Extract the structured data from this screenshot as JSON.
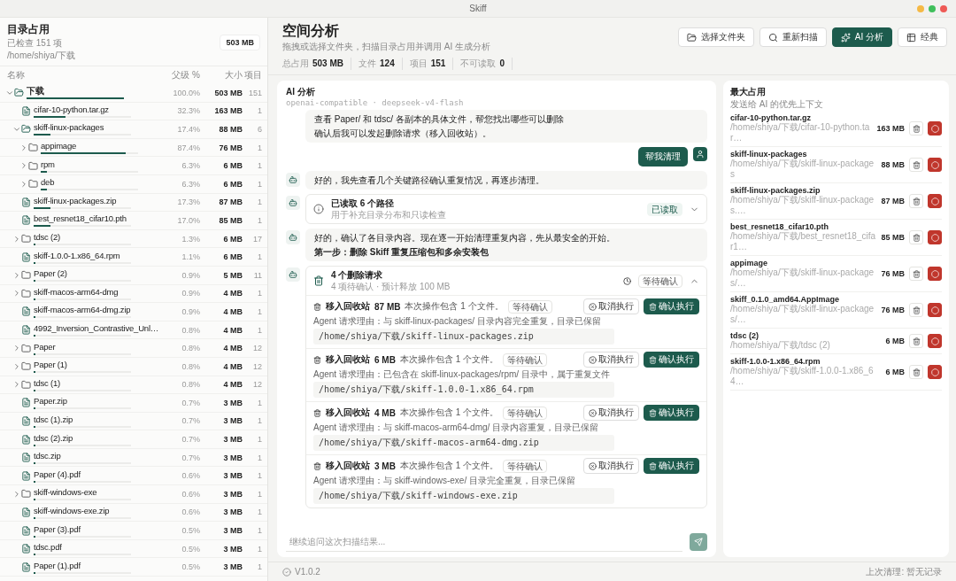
{
  "window": {
    "title": "Skiff"
  },
  "sidebar": {
    "title": "目录占用",
    "checked": "已检查 151 项",
    "path": "/home/shiya/下载",
    "total": "503 MB",
    "columns": [
      "名称",
      "父级 %",
      "大小",
      "项目"
    ],
    "tree": [
      {
        "name": "下载",
        "kind": "folder",
        "expanded": true,
        "percent": "100.0%",
        "size": "503 MB",
        "count": "151",
        "level": 1,
        "children": [
          {
            "name": "cifar-10-python.tar.gz",
            "kind": "file",
            "percent": "32.3%",
            "size": "163 MB",
            "count": "1",
            "level": 0.323
          },
          {
            "name": "skiff-linux-packages",
            "kind": "folder",
            "expanded": true,
            "percent": "17.4%",
            "size": "88 MB",
            "count": "6",
            "level": 0.174,
            "children": [
              {
                "name": "appimage",
                "kind": "folder",
                "expanded": false,
                "percent": "87.4%",
                "size": "76 MB",
                "count": "1",
                "level": 0.874
              },
              {
                "name": "rpm",
                "kind": "folder",
                "expanded": false,
                "percent": "6.3%",
                "size": "6 MB",
                "count": "1",
                "level": 0.063
              },
              {
                "name": "deb",
                "kind": "folder",
                "expanded": false,
                "percent": "6.3%",
                "size": "6 MB",
                "count": "1",
                "level": 0.063
              }
            ]
          },
          {
            "name": "skiff-linux-packages.zip",
            "kind": "file",
            "percent": "17.3%",
            "size": "87 MB",
            "count": "1",
            "level": 0.173
          },
          {
            "name": "best_resnet18_cifar10.pth",
            "kind": "file",
            "percent": "17.0%",
            "size": "85 MB",
            "count": "1",
            "level": 0.17
          },
          {
            "name": "tdsc (2)",
            "kind": "folder",
            "expanded": false,
            "percent": "1.3%",
            "size": "6 MB",
            "count": "17",
            "level": 0.013
          },
          {
            "name": "skiff-1.0.0-1.x86_64.rpm",
            "kind": "file",
            "percent": "1.1%",
            "size": "6 MB",
            "count": "1",
            "level": 0.011
          },
          {
            "name": "Paper (2)",
            "kind": "folder",
            "expanded": false,
            "percent": "0.9%",
            "size": "5 MB",
            "count": "11",
            "level": 0.009
          },
          {
            "name": "skiff-macos-arm64-dmg",
            "kind": "folder",
            "expanded": false,
            "percent": "0.9%",
            "size": "4 MB",
            "count": "1",
            "level": 0.009
          },
          {
            "name": "skiff-macos-arm64-dmg.zip",
            "kind": "file",
            "percent": "0.9%",
            "size": "4 MB",
            "count": "1",
            "level": 0.009
          },
          {
            "name": "4992_Inversion_Contrastive_Unl…",
            "kind": "file",
            "percent": "0.8%",
            "size": "4 MB",
            "count": "1",
            "level": 0.008
          },
          {
            "name": "Paper",
            "kind": "folder",
            "expanded": false,
            "percent": "0.8%",
            "size": "4 MB",
            "count": "12",
            "level": 0.008
          },
          {
            "name": "Paper (1)",
            "kind": "folder",
            "expanded": false,
            "percent": "0.8%",
            "size": "4 MB",
            "count": "12",
            "level": 0.008
          },
          {
            "name": "tdsc (1)",
            "kind": "folder",
            "expanded": false,
            "percent": "0.8%",
            "size": "4 MB",
            "count": "12",
            "level": 0.008
          },
          {
            "name": "Paper.zip",
            "kind": "file",
            "percent": "0.7%",
            "size": "3 MB",
            "count": "1",
            "level": 0.007
          },
          {
            "name": "tdsc (1).zip",
            "kind": "file",
            "percent": "0.7%",
            "size": "3 MB",
            "count": "1",
            "level": 0.007
          },
          {
            "name": "tdsc (2).zip",
            "kind": "file",
            "percent": "0.7%",
            "size": "3 MB",
            "count": "1",
            "level": 0.007
          },
          {
            "name": "tdsc.zip",
            "kind": "file",
            "percent": "0.7%",
            "size": "3 MB",
            "count": "1",
            "level": 0.007
          },
          {
            "name": "Paper (4).pdf",
            "kind": "file",
            "percent": "0.6%",
            "size": "3 MB",
            "count": "1",
            "level": 0.006
          },
          {
            "name": "skiff-windows-exe",
            "kind": "folder",
            "expanded": false,
            "percent": "0.6%",
            "size": "3 MB",
            "count": "1",
            "level": 0.006
          },
          {
            "name": "skiff-windows-exe.zip",
            "kind": "file",
            "percent": "0.6%",
            "size": "3 MB",
            "count": "1",
            "level": 0.006
          },
          {
            "name": "Paper (3).pdf",
            "kind": "file",
            "percent": "0.5%",
            "size": "3 MB",
            "count": "1",
            "level": 0.005
          },
          {
            "name": "tdsc.pdf",
            "kind": "file",
            "percent": "0.5%",
            "size": "3 MB",
            "count": "1",
            "level": 0.005
          },
          {
            "name": "Paper (1).pdf",
            "kind": "file",
            "percent": "0.5%",
            "size": "3 MB",
            "count": "1",
            "level": 0.005
          }
        ]
      }
    ]
  },
  "header": {
    "title": "空间分析",
    "subtitle": "拖拽或选择文件夹，扫描目录占用并调用 AI 生成分析",
    "buttons": [
      {
        "kind": "folder",
        "label": "选择文件夹",
        "selected": false
      },
      {
        "kind": "search",
        "label": "重新扫描",
        "selected": false
      },
      {
        "kind": "ai",
        "label": "AI 分析",
        "selected": true
      },
      {
        "kind": "table",
        "label": "经典",
        "selected": false
      }
    ],
    "stats": [
      {
        "label": "总占用",
        "value": "503 MB"
      },
      {
        "label": "文件",
        "value": "124"
      },
      {
        "label": "项目",
        "value": "151"
      },
      {
        "label": "不可读取",
        "value": "0"
      }
    ]
  },
  "ai_panel": {
    "title": "AI 分析",
    "model": "openai-compatible · deepseek-v4-flash",
    "messages": [
      {
        "kind": "continued",
        "lines": [
          {
            "text": "查看 Paper/ 和 tdsc/ 各副本的具体文件，帮您找出哪些可以删除",
            "strong": false
          },
          {
            "text": "确认后我可以发起删除请求（移入回收站）。",
            "strong": false
          }
        ]
      },
      {
        "kind": "user",
        "text": "帮我清理"
      },
      {
        "kind": "assistant",
        "lines": [
          {
            "text": "好的，我先查看几个关键路径确认重复情况，再逐步清理。",
            "strong": false
          }
        ]
      },
      {
        "kind": "tool",
        "title": "已读取 6 个路径",
        "subtitle": "用于补充目录分布和只读检查",
        "status": "已读取",
        "expanded": false
      },
      {
        "kind": "assistant",
        "lines": [
          {
            "text": "好的，确认了各目录内容。现在逐一开始清理重复内容，先从最安全的开始。",
            "strong": false
          },
          {
            "text": "第一步：删除 Skiff 重复压缩包和多余安装包",
            "strong": true
          }
        ]
      },
      {
        "kind": "requests",
        "title": "4 个删除请求",
        "subtitle": "4 项待确认 · 预计释放 100 MB",
        "status": "等待确认",
        "expanded": true,
        "items": [
          {
            "action": "移入回收站",
            "size": "87 MB",
            "note": "本次操作包含 1 个文件。",
            "status": "等待确认",
            "reason": "Agent 请求理由：与 skiff-linux-packages/ 目录内容完全重复，目录已保留",
            "path": "/home/shiya/下载/skiff-linux-packages.zip",
            "cancel": "取消执行",
            "confirm": "确认执行"
          },
          {
            "action": "移入回收站",
            "size": "6 MB",
            "note": "本次操作包含 1 个文件。",
            "status": "等待确认",
            "reason": "Agent 请求理由：已包含在 skiff-linux-packages/rpm/ 目录中，属于重复文件",
            "path": "/home/shiya/下载/skiff-1.0.0-1.x86_64.rpm",
            "cancel": "取消执行",
            "confirm": "确认执行"
          },
          {
            "action": "移入回收站",
            "size": "4 MB",
            "note": "本次操作包含 1 个文件。",
            "status": "等待确认",
            "reason": "Agent 请求理由：与 skiff-macos-arm64-dmg/ 目录内容重复，目录已保留",
            "path": "/home/shiya/下载/skiff-macos-arm64-dmg.zip",
            "cancel": "取消执行",
            "confirm": "确认执行"
          },
          {
            "action": "移入回收站",
            "size": "3 MB",
            "note": "本次操作包含 1 个文件。",
            "status": "等待确认",
            "reason": "Agent 请求理由：与 skiff-windows-exe/ 目录完全重复，目录已保留",
            "path": "/home/shiya/下载/skiff-windows-exe.zip",
            "cancel": "取消执行",
            "confirm": "确认执行"
          }
        ]
      }
    ],
    "input": {
      "placeholder": "继续追问这次扫描结果..."
    }
  },
  "largest": {
    "title": "最大占用",
    "subtitle": "发送给 AI 的优先上下文",
    "items": [
      {
        "name": "cifar-10-python.tar.gz",
        "path": "/home/shiya/下载/cifar-10-python.tar…",
        "size": "163 MB"
      },
      {
        "name": "skiff-linux-packages",
        "path": "/home/shiya/下载/skiff-linux-packages",
        "size": "88 MB"
      },
      {
        "name": "skiff-linux-packages.zip",
        "path": "/home/shiya/下载/skiff-linux-packages.…",
        "size": "87 MB"
      },
      {
        "name": "best_resnet18_cifar10.pth",
        "path": "/home/shiya/下载/best_resnet18_cifar1…",
        "size": "85 MB"
      },
      {
        "name": "appimage",
        "path": "/home/shiya/下载/skiff-linux-packages/…",
        "size": "76 MB"
      },
      {
        "name": "skiff_0.1.0_amd64.AppImage",
        "path": "/home/shiya/下载/skiff-linux-packages/…",
        "size": "76 MB"
      },
      {
        "name": "tdsc (2)",
        "path": "/home/shiya/下载/tdsc (2)",
        "size": "6 MB"
      },
      {
        "name": "skiff-1.0.0-1.x86_64.rpm",
        "path": "/home/shiya/下载/skiff-1.0.0-1.x86_64…",
        "size": "6 MB"
      }
    ]
  },
  "status_bar": {
    "version": "V1.0.2",
    "last_clean": "上次清理: 暂无记录"
  }
}
